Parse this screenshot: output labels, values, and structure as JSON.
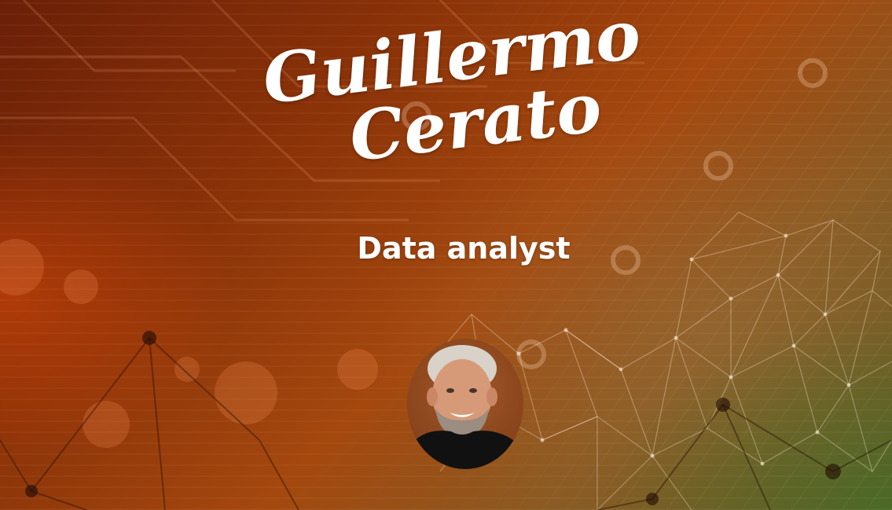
{
  "profile": {
    "name_line_1": "Guillermo",
    "name_line_2": "Cerato",
    "role": "Data analyst"
  },
  "icons": {
    "avatar": "profile-photo"
  },
  "colors": {
    "text": "#ffffff",
    "background_orange": "#a4480e",
    "background_green": "#5b5a22"
  }
}
